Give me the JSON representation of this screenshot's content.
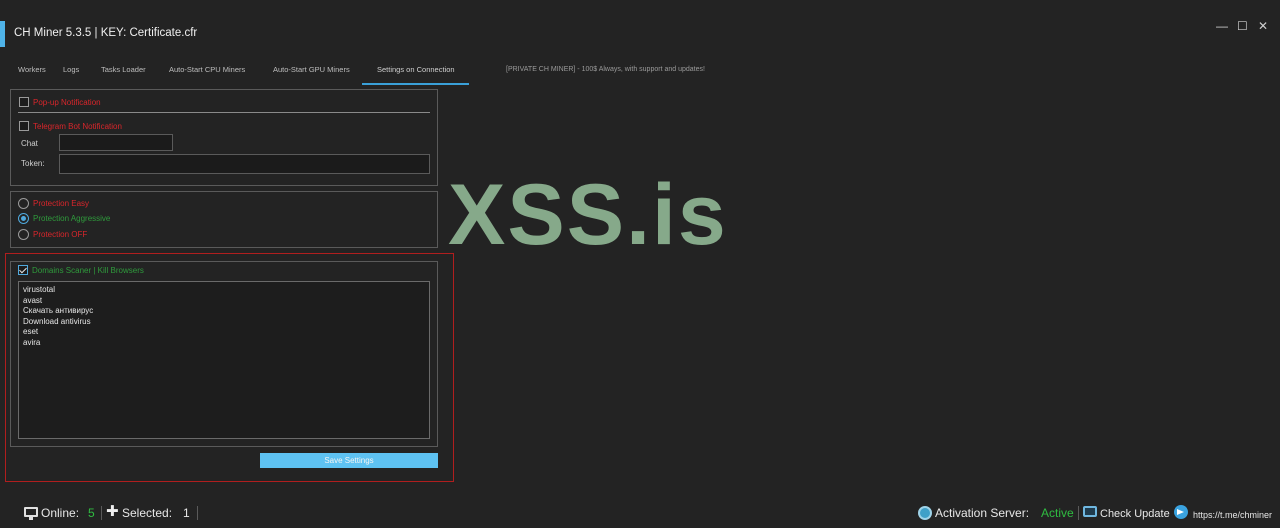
{
  "window": {
    "title": "CH Miner 5.3.5 | KEY: Certificate.cfr",
    "controls": {
      "minimize": "—",
      "maximize": "☐",
      "close": "✕"
    },
    "accent_color": "#4fb3e8"
  },
  "tabs": [
    {
      "label": "Workers"
    },
    {
      "label": "Logs"
    },
    {
      "label": "Tasks Loader"
    },
    {
      "label": "Auto-Start CPU Miners"
    },
    {
      "label": "Auto-Start GPU Miners"
    },
    {
      "label": "Settings on Connection",
      "active": true
    }
  ],
  "tab_info": "[PRIVATE CH MINER] - 100$ Always, with support and updates!",
  "notifications": {
    "popup_label": "Pop-up Notification",
    "popup_checked": false,
    "telegram_label": "Telegram Bot Notification",
    "telegram_checked": false,
    "chat_label": "Chat",
    "chat_value": "",
    "token_label": "Token:",
    "token_value": ""
  },
  "protection": {
    "options": [
      {
        "label": "Protection Easy",
        "selected": false,
        "color": "#d9262b"
      },
      {
        "label": "Protection Aggressive",
        "selected": true,
        "color": "#2f9b3c"
      },
      {
        "label": "Protection OFF",
        "selected": false,
        "color": "#d9262b"
      }
    ]
  },
  "domains": {
    "label": "Domains Scaner | Kill Browsers",
    "checked": true,
    "items": [
      "virustotal",
      "avast",
      "Скачать антивирус",
      "Download antivirus",
      "eset",
      "avira"
    ]
  },
  "save_label": "Save Settings",
  "watermark": "XSS.is",
  "status": {
    "online_label": "Online:",
    "online_value": "5",
    "selected_label": "Selected:",
    "selected_value": "1",
    "activation_label": "Activation Server:",
    "activation_value": "Active",
    "check_update_label": "Check Update",
    "telegram_link": "https://t.me/chminer"
  },
  "colors": {
    "background": "#232323",
    "red": "#d9262b",
    "green": "#2f9b3c",
    "button": "#5ec2f2",
    "frame": "#b01e1e"
  }
}
